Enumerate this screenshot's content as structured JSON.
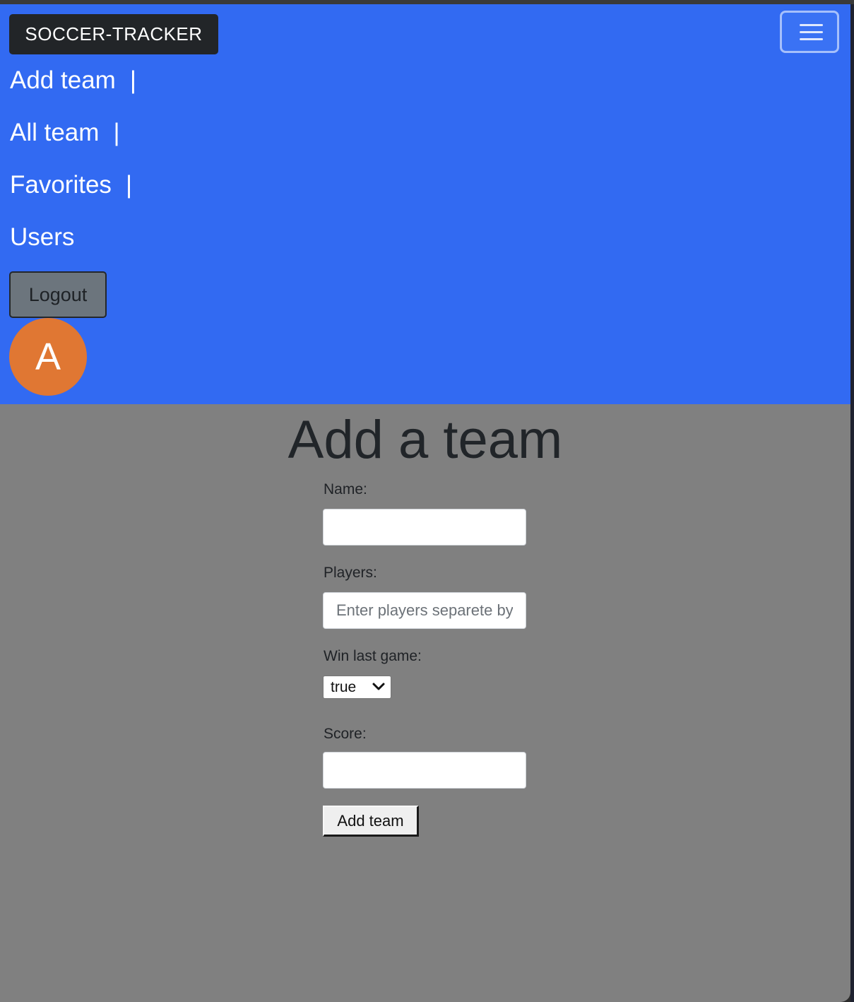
{
  "navbar": {
    "brand": "SOCCER-TRACKER",
    "links": [
      {
        "label": "Add team",
        "sep": "|"
      },
      {
        "label": "All team",
        "sep": "|"
      },
      {
        "label": "Favorites",
        "sep": "|"
      },
      {
        "label": "Users",
        "sep": ""
      }
    ],
    "logout_label": "Logout",
    "avatar_initial": "A",
    "toggler_icon": "hamburger-menu-icon"
  },
  "form": {
    "title": "Add a team",
    "name_label": "Name:",
    "name_value": "",
    "players_label": "Players:",
    "players_placeholder": "Enter players separete by comma",
    "win_label": "Win last game:",
    "win_value": "true",
    "score_label": "Score:",
    "score_value": "",
    "submit_label": "Add team"
  },
  "colors": {
    "navbar_bg": "#326af2",
    "page_bg": "#808080",
    "brand_bg": "#222528",
    "avatar_bg": "#e07733",
    "logout_bg": "#6c757d"
  }
}
